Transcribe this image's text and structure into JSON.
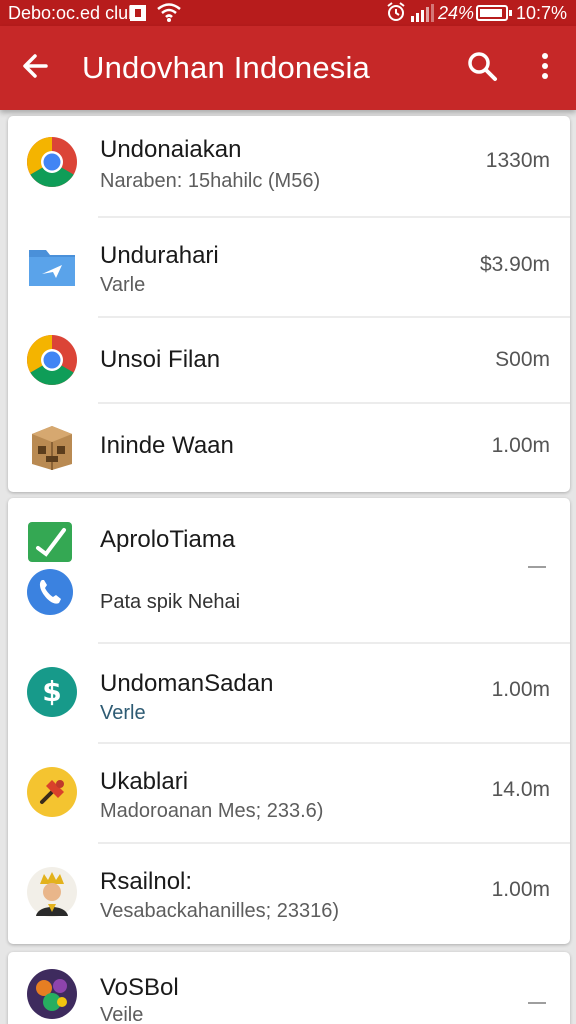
{
  "status_bar": {
    "carrier": "Debo:oc.ed clul",
    "battery_percent": "24%",
    "time": "10:7%",
    "icons": [
      "notification-square-icon",
      "wifi-icon",
      "alarm-icon",
      "signal-icon",
      "battery-icon"
    ]
  },
  "app_bar": {
    "title": "Undovhan Indonesia",
    "back_icon": "arrow-left-icon",
    "search_icon": "search-icon",
    "menu_icon": "more-vertical-icon"
  },
  "accent_color": "#c62828",
  "groups": [
    {
      "items": [
        {
          "icon": "chrome-icon",
          "name": "Undonaiakan",
          "subtitle": "Naraben: 15hahilc (M56)",
          "value": "1330m"
        },
        {
          "icon": "folder-plane-icon",
          "name": "Undurahari",
          "subtitle": "Varle",
          "value": "$3.90m"
        },
        {
          "icon": "chrome-icon",
          "name": "Unsoi Filan",
          "subtitle": "",
          "value": "S00m"
        },
        {
          "icon": "package-box-icon",
          "name": "Ininde Waan",
          "subtitle": "",
          "value": "1.00m"
        }
      ]
    },
    {
      "items": [
        {
          "icon": "green-check-app-icon",
          "name": "AproloTiama",
          "subtitle": "",
          "value": "—"
        },
        {
          "icon": "phone-icon",
          "name": "",
          "subtitle": "Pata spik Nehai",
          "value": ""
        },
        {
          "icon": "dollar-circle-icon",
          "name": "UndomanSadan",
          "subtitle": "Verle",
          "value": "1.00m"
        },
        {
          "icon": "yellow-app-icon",
          "name": "Ukablari",
          "subtitle": "Madoroanan Mes; 233.6)",
          "value": "14.0m"
        },
        {
          "icon": "king-avatar-icon",
          "name": "Rsailnol:",
          "subtitle": "Vesabackahanilles; 23316)",
          "value": "1.00m"
        }
      ]
    },
    {
      "items": [
        {
          "icon": "game-art-icon",
          "name": "VoSBol",
          "subtitle": "Veile",
          "value": "—"
        }
      ]
    }
  ]
}
